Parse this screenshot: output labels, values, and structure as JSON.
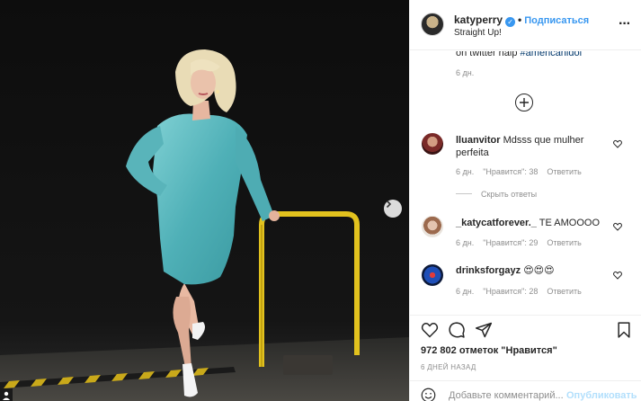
{
  "post": {
    "username": "katyperry",
    "follow_label": "Подписаться",
    "subtitle": "Straight Up!",
    "more_icon": "more-horizontal-icon"
  },
  "caption": {
    "tail_text": "on twitter halp ",
    "hashtag": "#americanidol",
    "age": "6 дн."
  },
  "comments": [
    {
      "username": "lluanvitor",
      "text": "Mdsss que mulher",
      "text2": "perfeita",
      "age": "6 дн.",
      "likes": "\"Нравится\": 38",
      "reply": "Ответить"
    },
    {
      "username": "_katycatforever._",
      "text": "TE AMOOOO",
      "age": "6 дн.",
      "likes": "\"Нравится\": 29",
      "reply": "Ответить"
    },
    {
      "username": "drinksforgayz",
      "text": "😍😍😍",
      "age": "6 дн.",
      "likes": "\"Нравится\": 28",
      "reply": "Ответить"
    }
  ],
  "hide_replies": "Скрыть ответы",
  "stats": {
    "likes": "972 802 отметок \"Нравится\"",
    "time": "6 ДНЕЙ НАЗАД"
  },
  "composer": {
    "placeholder": "Добавьте комментарий...",
    "publish": "Опубликовать"
  },
  "colors": {
    "link": "#3897f0",
    "dress": "#5fb8bf",
    "rail": "#e2c21e"
  }
}
